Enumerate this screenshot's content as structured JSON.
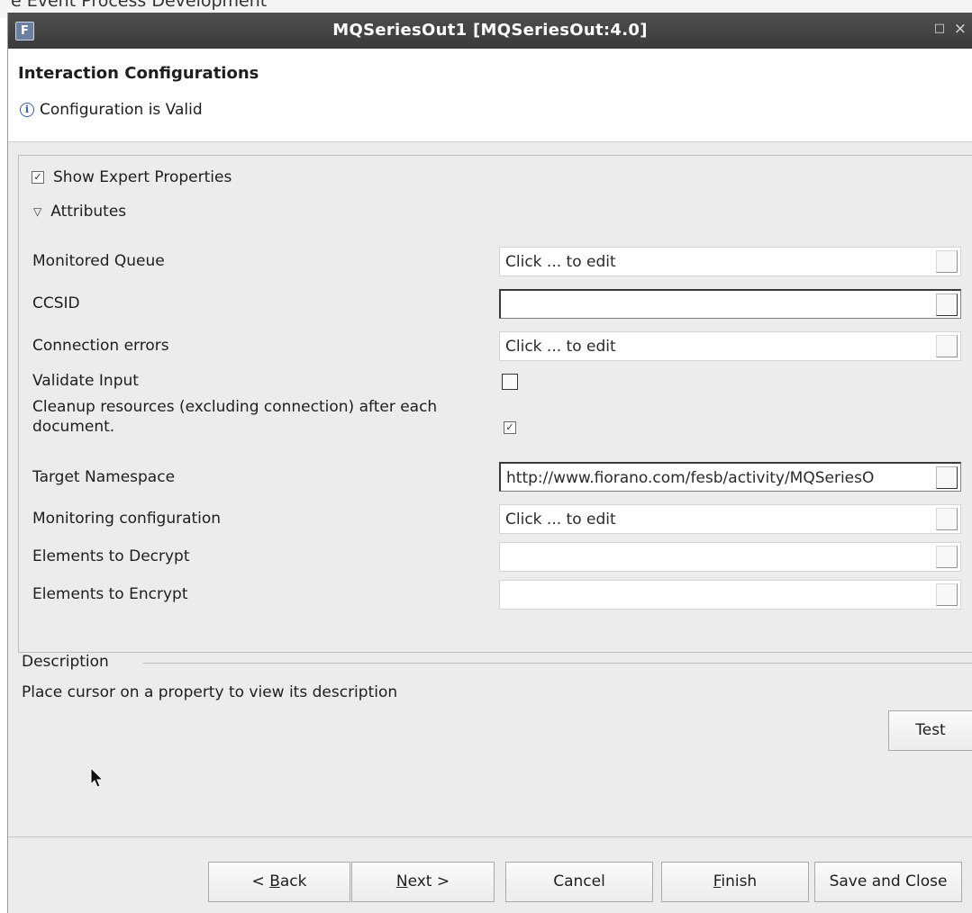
{
  "background_window": {
    "title": "e Event Process Development"
  },
  "window": {
    "title": "MQSeriesOut1 [MQSeriesOut:4.0]",
    "icon": "app-logo-icon",
    "maximize_glyph": "□",
    "close_glyph": "×"
  },
  "header": {
    "title": "Interaction Configurations",
    "status_icon": "info-icon",
    "status": "Configuration is Valid"
  },
  "expert": {
    "label": "Show Expert Properties",
    "checked": true
  },
  "attributes": {
    "label": "Attributes",
    "expanded": true
  },
  "properties": [
    {
      "label": "Monitored Queue",
      "type": "edit",
      "value": "Click ... to edit"
    },
    {
      "label": "CCSID",
      "type": "text",
      "value": ""
    },
    {
      "label": "Connection errors",
      "type": "edit",
      "value": "Click ... to edit"
    },
    {
      "label": "Validate Input",
      "type": "checkbox",
      "checked": false
    },
    {
      "label": "Cleanup resources (excluding connection) after each document.",
      "type": "checkbox",
      "checked": true
    },
    {
      "label": "Target Namespace",
      "type": "text",
      "value": "http://www.fiorano.com/fesb/activity/MQSeriesO"
    },
    {
      "label": "Monitoring configuration",
      "type": "edit",
      "value": "Click ... to edit"
    },
    {
      "label": "Elements to Decrypt",
      "type": "edit",
      "value": ""
    },
    {
      "label": "Elements to Encrypt",
      "type": "edit",
      "value": ""
    }
  ],
  "description": {
    "legend": "Description",
    "text": "Place cursor on a property to view its description"
  },
  "buttons": {
    "test": "Test",
    "back_mnemonic": "B",
    "back_prefix": "< ",
    "back_rest": "ack",
    "next_mnemonic": "N",
    "next_rest": "ext >",
    "cancel": "Cancel",
    "finish_mnemonic": "F",
    "finish_rest": "inish",
    "save_close": "Save and Close"
  }
}
